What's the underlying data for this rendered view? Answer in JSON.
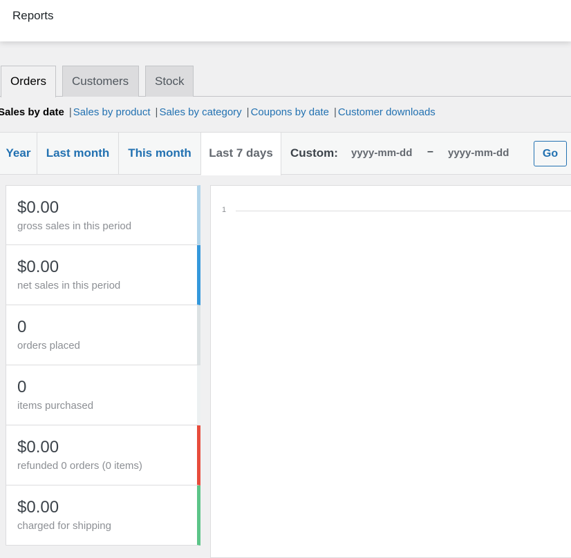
{
  "header": {
    "title": "Reports"
  },
  "tabs": [
    {
      "label": "Orders",
      "active": true
    },
    {
      "label": "Customers"
    },
    {
      "label": "Stock"
    }
  ],
  "subnav": {
    "current": "Sales by date",
    "links": [
      "Sales by product",
      "Sales by category",
      "Coupons by date",
      "Customer downloads"
    ]
  },
  "ranges": [
    {
      "label": "Year"
    },
    {
      "label": "Last month"
    },
    {
      "label": "This month"
    },
    {
      "label": "Last 7 days",
      "active": true
    }
  ],
  "custom": {
    "label": "Custom:",
    "from_placeholder": "yyyy-mm-dd",
    "separator": "–",
    "to_placeholder": "yyyy-mm-dd",
    "go_label": "Go"
  },
  "legend": [
    {
      "amount": "$0.00",
      "label": "gross sales in this period",
      "color": "#b1d4ea"
    },
    {
      "amount": "$0.00",
      "label": "net sales in this period",
      "color": "#3498db"
    },
    {
      "amount": "0",
      "label": "orders placed",
      "color": "#dbe1e3"
    },
    {
      "amount": "0",
      "label": "items purchased",
      "color": "#ecf0f1"
    },
    {
      "amount": "$0.00",
      "label": "refunded 0 orders (0 items)",
      "color": "#e74c3c"
    },
    {
      "amount": "$0.00",
      "label": "charged for shipping",
      "color": "#5cc488"
    }
  ],
  "chart": {
    "y_tick": "1"
  }
}
